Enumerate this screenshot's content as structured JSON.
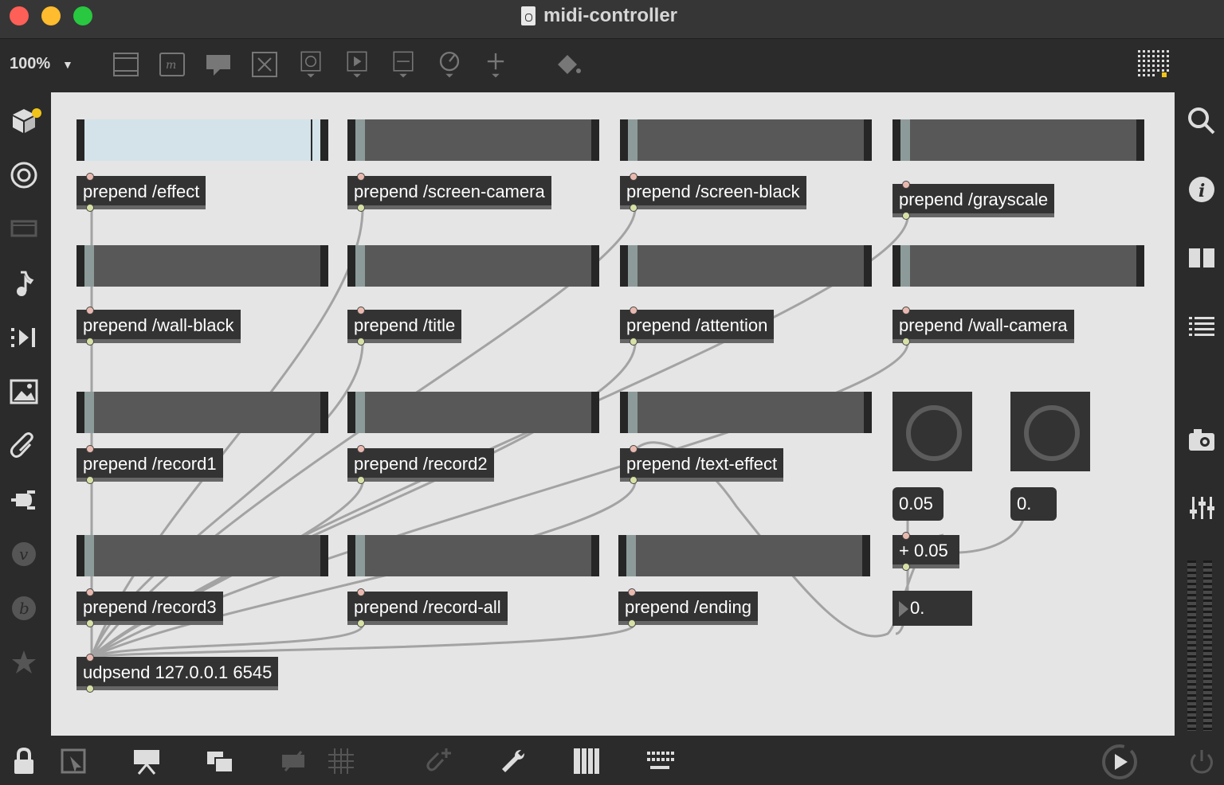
{
  "window": {
    "title": "midi-controller"
  },
  "toolbar": {
    "zoom_label": "100%",
    "icons": [
      "slider-object-icon",
      "message-object-icon",
      "comment-icon",
      "toggle-icon",
      "button-icon",
      "play-icon",
      "number-icon",
      "dial-icon",
      "add-icon",
      "paint-bucket-icon",
      "grid-toggle-icon"
    ]
  },
  "patch": {
    "row1": [
      {
        "label": "prepend /effect"
      },
      {
        "label": "prepend /screen-camera"
      },
      {
        "label": "prepend /screen-black"
      },
      {
        "label": "prepend /grayscale"
      }
    ],
    "row2": [
      {
        "label": "prepend /wall-black"
      },
      {
        "label": "prepend /title"
      },
      {
        "label": "prepend /attention"
      },
      {
        "label": "prepend /wall-camera"
      }
    ],
    "row3": [
      {
        "label": "prepend /record1"
      },
      {
        "label": "prepend /record2"
      },
      {
        "label": "prepend /text-effect"
      }
    ],
    "row4": [
      {
        "label": "prepend /record3"
      },
      {
        "label": "prepend /record-all"
      },
      {
        "label": "prepend /ending"
      }
    ],
    "udpsend": "udpsend 127.0.0.1 6545",
    "number_left": "0.05",
    "number_right": "0.",
    "plus_obj": "+ 0.05",
    "flonum": "0."
  },
  "colors": {
    "close": "#fe5f57",
    "minimize": "#febc2e",
    "zoom": "#28c840",
    "canvas": "#e5e5e5",
    "object": "#333333",
    "slider_active": "#d3e3e9"
  }
}
